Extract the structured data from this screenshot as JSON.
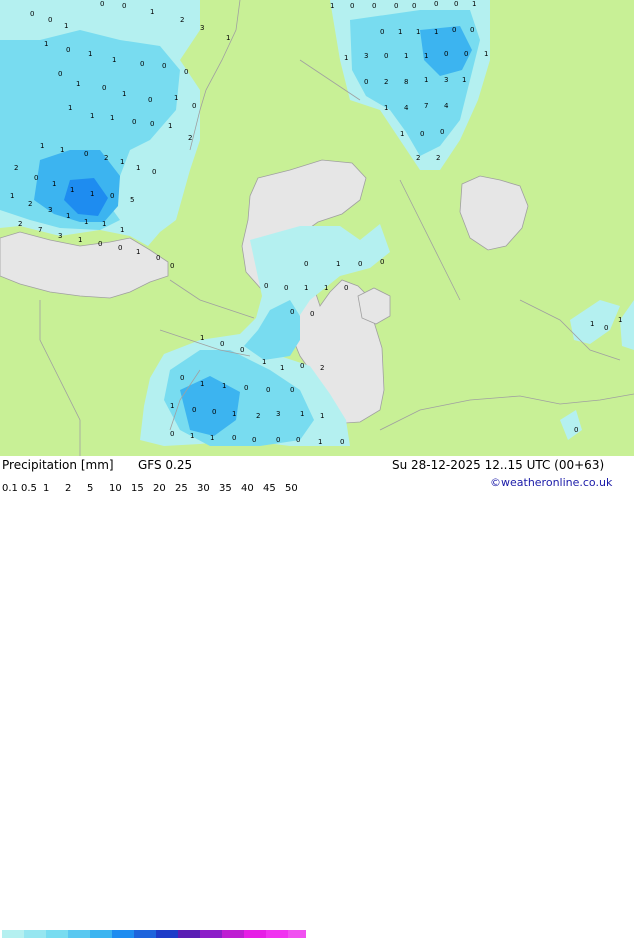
{
  "title": "Precipitation [mm]",
  "model": "GFS 0.25",
  "valid_time": "Su 28-12-2025 12..15 UTC (00+63)",
  "credit": "©weatheronline.co.uk",
  "legend": {
    "ticks": [
      "0.1",
      "0.5",
      "1",
      "2",
      "5",
      "10",
      "15",
      "20",
      "25",
      "30",
      "35",
      "40",
      "45",
      "50"
    ],
    "colors": [
      "#b4f0f0",
      "#96e6f0",
      "#78dcf0",
      "#5ac8f0",
      "#3cb4f0",
      "#1e8cf0",
      "#1e64dc",
      "#1e3cc8",
      "#5a1eb4",
      "#8c1ec8",
      "#be1ed2",
      "#e61ee6",
      "#f032f0",
      "#f050f0"
    ]
  },
  "colors": {
    "land": "#c8f096",
    "water": "#e6e6e6",
    "border": "#a0a0a0",
    "precip_light": "#b4f0f0",
    "precip_medium": "#78dcf0",
    "precip_heavy": "#3cb4f0",
    "precip_very_heavy": "#1e8cf0"
  },
  "grid_labels": [
    "0",
    "0",
    "1",
    "0",
    "0",
    "1",
    "2",
    "3",
    "1",
    "1",
    "0",
    "1",
    "1",
    "0",
    "0",
    "0",
    "0",
    "1",
    "0",
    "1",
    "0",
    "1",
    "0",
    "1",
    "1",
    "1",
    "0",
    "0",
    "1",
    "2",
    "1",
    "1",
    "0",
    "2",
    "1",
    "1",
    "0",
    "2",
    "0",
    "1",
    "1",
    "1",
    "0",
    "5",
    "1",
    "2",
    "3",
    "1",
    "1",
    "1",
    "1",
    "2",
    "7",
    "3",
    "1",
    "0",
    "0",
    "1",
    "0",
    "0",
    "1",
    "0",
    "0",
    "0",
    "0",
    "0",
    "0",
    "1",
    "0",
    "1",
    "1",
    "1",
    "0",
    "0",
    "1",
    "3",
    "0",
    "1",
    "1",
    "0",
    "0",
    "1",
    "0",
    "2",
    "8",
    "1",
    "3",
    "1",
    "1",
    "4",
    "7",
    "4",
    "1",
    "0",
    "0",
    "2",
    "2",
    "0",
    "1",
    "0",
    "0",
    "0",
    "0",
    "1",
    "1",
    "0",
    "0",
    "0",
    "1",
    "0",
    "0",
    "1",
    "1",
    "0",
    "2",
    "0",
    "1",
    "1",
    "0"
  ]
}
